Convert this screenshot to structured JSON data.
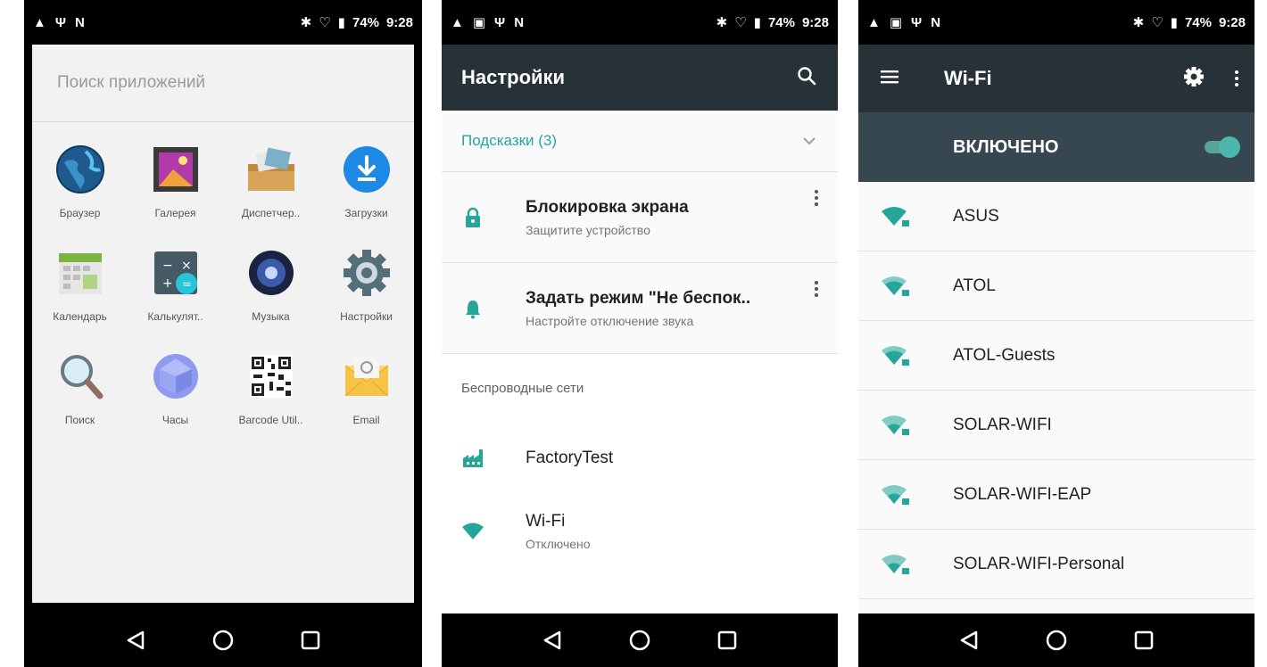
{
  "status": {
    "battery": "74%",
    "time": "9:28"
  },
  "colors": {
    "toolbar": "#263238",
    "switchbar": "#37474f",
    "accent": "#26a69a",
    "toggle": "#4db6ac"
  },
  "launcher": {
    "search_placeholder": "Поиск приложений",
    "apps": [
      {
        "label": "Браузер",
        "icon": "browser-globe-icon"
      },
      {
        "label": "Галерея",
        "icon": "gallery-icon"
      },
      {
        "label": "Диспетчер..",
        "icon": "file-manager-icon"
      },
      {
        "label": "Загрузки",
        "icon": "downloads-icon"
      },
      {
        "label": "Календарь",
        "icon": "calendar-icon"
      },
      {
        "label": "Калькулят..",
        "icon": "calculator-icon"
      },
      {
        "label": "Музыка",
        "icon": "music-icon"
      },
      {
        "label": "Настройки",
        "icon": "settings-gear-icon"
      },
      {
        "label": "Поиск",
        "icon": "search-magnifier-icon"
      },
      {
        "label": "Часы",
        "icon": "clock-icon"
      },
      {
        "label": "Barcode Util..",
        "icon": "qr-code-icon"
      },
      {
        "label": "Email",
        "icon": "email-icon"
      }
    ]
  },
  "settings": {
    "title": "Настройки",
    "suggestions_header": "Подсказки (3)",
    "suggestions": [
      {
        "title": "Блокировка экрана",
        "subtitle": "Защитите устройство",
        "icon": "lock-icon"
      },
      {
        "title": "Задать режим \"Не беспок..",
        "subtitle": "Настройте отключение звука",
        "icon": "bell-icon"
      }
    ],
    "section_wireless": "Беспроводные сети",
    "items": [
      {
        "title": "FactoryTest",
        "subtitle": "",
        "icon": "factory-icon"
      },
      {
        "title": "Wi-Fi",
        "subtitle": "Отключено",
        "icon": "wifi-icon"
      }
    ]
  },
  "wifi": {
    "title": "Wi-Fi",
    "state": "ВКЛЮЧЕНО",
    "networks": [
      {
        "name": "ASUS",
        "icon": "wifi-lock-icon"
      },
      {
        "name": "ATOL",
        "icon": "wifi-lock-icon"
      },
      {
        "name": "ATOL-Guests",
        "icon": "wifi-lock-icon"
      },
      {
        "name": "SOLAR-WIFI",
        "icon": "wifi-lock-icon"
      },
      {
        "name": "SOLAR-WIFI-EAP",
        "icon": "wifi-lock-icon"
      },
      {
        "name": "SOLAR-WIFI-Personal",
        "icon": "wifi-lock-icon"
      }
    ]
  }
}
